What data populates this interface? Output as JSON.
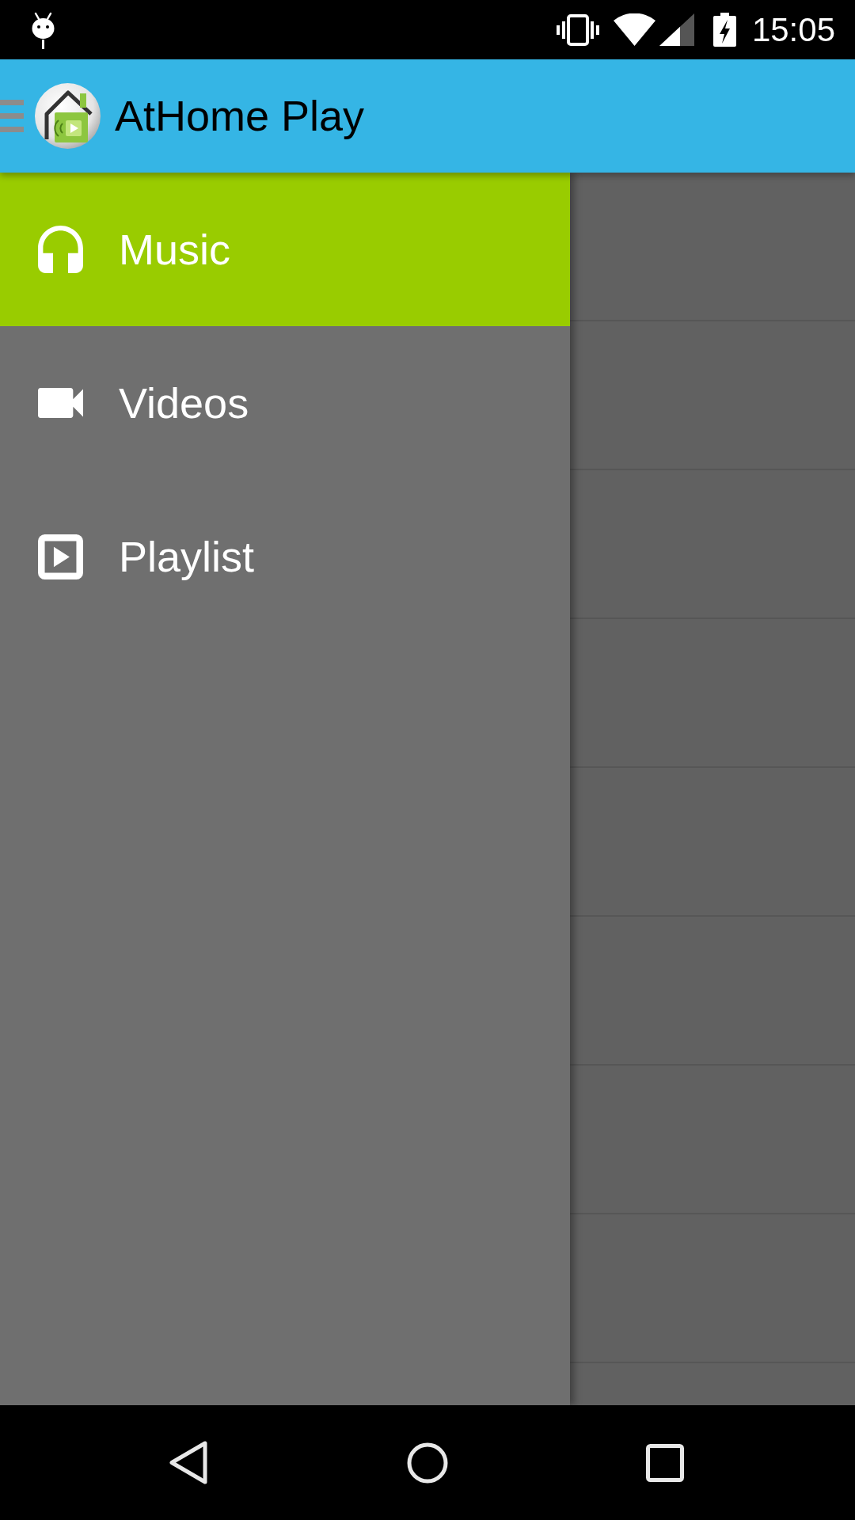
{
  "status_bar": {
    "time": "15:05"
  },
  "app_bar": {
    "title": "AtHome Play"
  },
  "drawer": {
    "items": [
      {
        "kind": "headphones",
        "label": "Music",
        "selected": true
      },
      {
        "kind": "camera",
        "label": "Videos",
        "selected": false
      },
      {
        "kind": "play-box",
        "label": "Playlist",
        "selected": false
      }
    ]
  }
}
